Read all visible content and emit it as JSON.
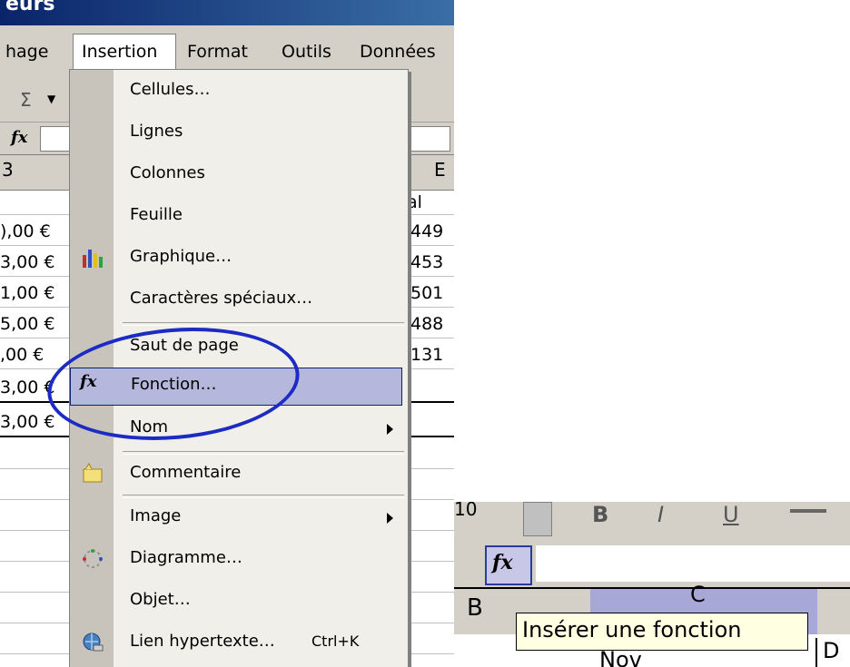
{
  "window": {
    "title": "eurs"
  },
  "menubar": {
    "items": [
      "hage",
      "Insertion",
      "Format",
      "Outils",
      "Données"
    ]
  },
  "toolbar": {
    "sigma": "Σ",
    "fx": "fx"
  },
  "spreadsheet": {
    "col_headers": [
      "3",
      "E"
    ],
    "header_right": "al",
    "rows": [
      {
        "left": "),00 €",
        "right": "449"
      },
      {
        "left": "3,00 €",
        "right": "453"
      },
      {
        "left": "1,00 €",
        "right": "501"
      },
      {
        "left": "5,00 €",
        "right": "488"
      },
      {
        "left": ",00 €",
        "right": "131"
      },
      {
        "left": "3,00 €",
        "right": ""
      },
      {
        "left": "3,00 €",
        "right": ""
      }
    ]
  },
  "insertion_menu": {
    "items": [
      {
        "label": "Cellules…",
        "icon": "none"
      },
      {
        "label": "Lignes",
        "icon": "none"
      },
      {
        "label": "Colonnes",
        "icon": "none"
      },
      {
        "label": "Feuille",
        "icon": "none"
      },
      {
        "label": "Graphique…",
        "icon": "chart-icon"
      },
      {
        "label": "Caractères spéciaux…",
        "icon": "none"
      },
      {
        "label": "Saut de page",
        "icon": "none"
      },
      {
        "label": "Fonction…",
        "icon": "function-icon",
        "highlighted": true
      },
      {
        "label": "Nom",
        "icon": "none",
        "submenu": true
      },
      {
        "label": "Commentaire",
        "icon": "comment-icon"
      },
      {
        "label": "Image",
        "icon": "none",
        "submenu": true
      },
      {
        "label": "Diagramme…",
        "icon": "diagram-icon"
      },
      {
        "label": "Objet…",
        "icon": "none"
      },
      {
        "label": "Lien hypertexte…",
        "icon": "hyperlink-icon",
        "shortcut": "Ctrl+K"
      }
    ]
  },
  "snippet": {
    "font_size_partial": "10",
    "col_b": "B",
    "col_c": "C",
    "cell_partial": "Nov",
    "cell_partial_right": "D",
    "tooltip": "Insérer une fonction"
  },
  "colors": {
    "highlight": "#b5b7dc",
    "oval": "#1c2bc4",
    "tooltip_bg": "#ffffe1"
  }
}
